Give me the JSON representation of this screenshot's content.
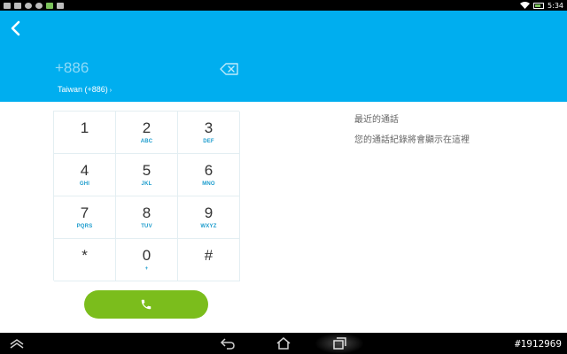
{
  "status_bar": {
    "time": "5:34",
    "notification_icons": [
      "image-icon",
      "mail-icon",
      "chrome-icon",
      "chrome-icon",
      "app-icon",
      "download-icon"
    ]
  },
  "dialer": {
    "number": "+886",
    "country_label": "Taiwan (+886)",
    "keys": [
      {
        "digit": "1",
        "letters": ""
      },
      {
        "digit": "2",
        "letters": "ABC"
      },
      {
        "digit": "3",
        "letters": "DEF"
      },
      {
        "digit": "4",
        "letters": "GHI"
      },
      {
        "digit": "5",
        "letters": "JKL"
      },
      {
        "digit": "6",
        "letters": "MNO"
      },
      {
        "digit": "7",
        "letters": "PQRS"
      },
      {
        "digit": "8",
        "letters": "TUV"
      },
      {
        "digit": "9",
        "letters": "WXYZ"
      },
      {
        "digit": "*",
        "letters": ""
      },
      {
        "digit": "0",
        "letters": "+"
      },
      {
        "digit": "#",
        "letters": ""
      }
    ]
  },
  "recents": {
    "title": "最近的通話",
    "empty_message": "您的通話紀錄將會顯示在這裡"
  },
  "watermark": "#1912969",
  "colors": {
    "header": "#00aeef",
    "call_button": "#7bbd1c",
    "key_letters": "#1c9ccd"
  }
}
